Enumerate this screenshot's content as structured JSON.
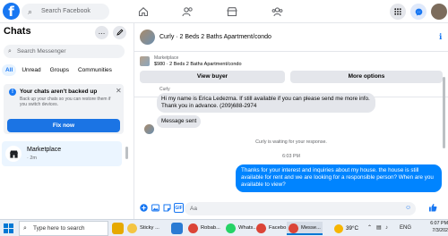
{
  "topbar": {
    "logo": "f",
    "search_placeholder": "Search Facebook",
    "icons": [
      "home-icon",
      "friends-icon",
      "marketplace-icon",
      "groups-icon",
      "grid-menu-icon",
      "messenger-icon",
      "notifications-icon"
    ]
  },
  "sidebar": {
    "title": "Chats",
    "more_label": "…",
    "search_placeholder": "Search Messenger",
    "filters": [
      "All",
      "Unread",
      "Groups",
      "Communities"
    ],
    "backup": {
      "title": "Your chats aren't backed up",
      "body": "Back up your chats so you can restore them if you switch devices.",
      "button": "Fix now"
    },
    "chat_item": {
      "name": "Marketplace",
      "time": "· 2m"
    }
  },
  "conversation": {
    "title": "Curly · 2 Beds 2 Baths Apartment/condo",
    "marketplace_label": "Marketplace",
    "listing": "$980 · 2 Beds 2 Baths Apartment/condo",
    "view_buyer": "View buyer",
    "more_options": "More options",
    "sender": "Curly",
    "msg1": "Hi my name is Erica Ledezma. If still available if you can please send me more info. Thank you in advance. (209)688-2974",
    "msg2": "Message sent",
    "waiting": "Curly is waiting for your response.",
    "time": "6:03 PM",
    "reply": "Thanks for your interest and inquiries about my house. the house is still available for rent and we are looking for a responsible person? When are you available to view?",
    "composer_placeholder": "Aa"
  },
  "taskbar": {
    "search_placeholder": "Type here to search",
    "apps": [
      "Sticky ...",
      "Robab...",
      "Whats...",
      "Facebo...",
      "Messe..."
    ],
    "weather": "39°C",
    "lang": "ENG",
    "time": "6:07 PM",
    "date": "7/3/202"
  },
  "colors": {
    "accent": "#1877f2",
    "outgoing_bubble": "#0084ff",
    "incoming_bubble": "#e4e6eb"
  }
}
